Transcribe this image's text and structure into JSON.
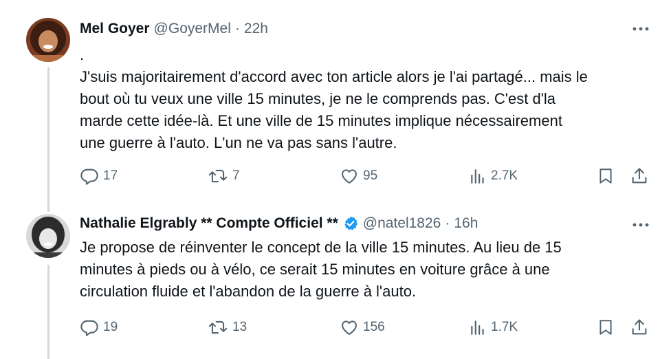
{
  "tweets": [
    {
      "name": "Mel Goyer",
      "handle": "@GoyerMel",
      "separator": "·",
      "time": "22h",
      "body_lines": [
        ".",
        "J'suis majoritairement d'accord avec ton article alors je l'ai partagé... mais le",
        "bout où tu veux une ville 15 minutes, je ne le comprends pas. C'est d'la",
        "marde cette idée-là. Et une ville de 15 minutes implique nécessairement",
        "une guerre à l'auto. L'un ne va pas sans l'autre."
      ],
      "replies": "17",
      "retweets": "7",
      "likes": "95",
      "views": "2.7K"
    },
    {
      "name": "Nathalie Elgrably ** Compte Officiel **",
      "handle": "@natel1826",
      "separator": "·",
      "time": "16h",
      "verified": true,
      "body_lines": [
        "Je propose de réinventer le concept de la ville 15 minutes.  Au lieu de 15",
        "minutes à pieds ou à vélo, ce serait 15 minutes en voiture grâce à une",
        "circulation fluide et l'abandon de la guerre à l'auto."
      ],
      "replies": "19",
      "retweets": "13",
      "likes": "156",
      "views": "1.7K"
    }
  ],
  "colors": {
    "text": "#0f1419",
    "secondary": "#536471",
    "verified": "#1d9bf0",
    "thread_line": "#cfd9de"
  },
  "icons": [
    "reply-icon",
    "retweet-icon",
    "like-icon",
    "views-icon",
    "bookmark-icon",
    "share-icon",
    "more-icon",
    "verified-badge-icon"
  ]
}
